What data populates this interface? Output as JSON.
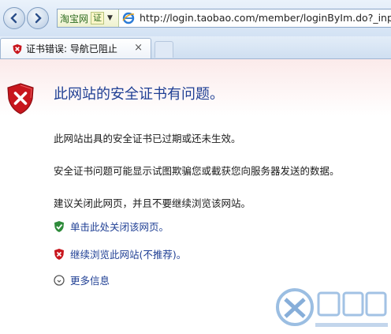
{
  "toolbar": {
    "back_icon": "back-arrow-icon",
    "forward_icon": "forward-arrow-icon",
    "compat_label": "淘宝网",
    "compat_badge": "证",
    "url": "http://login.taobao.com/member/loginByIm.do?_input_"
  },
  "tab": {
    "label": "证书错误: 导航已阻止",
    "close": "×"
  },
  "page": {
    "title": "此网站的安全证书有问题。",
    "paragraphs": [
      "此网站出具的安全证书已过期或还未生效。",
      "安全证书问题可能显示试图欺骗您或截获您向服务器发送的数据。",
      "建议关闭此网页，并且不要继续浏览该网站。"
    ],
    "actions": [
      {
        "label": "单击此处关闭该网页。",
        "icon": "green-shield-icon"
      },
      {
        "label": "继续浏览此网站(不推荐)。",
        "icon": "red-shield-icon"
      },
      {
        "label": "更多信息",
        "icon": "info-icon"
      }
    ]
  },
  "colors": {
    "title": "#1f3f94",
    "link": "#1f3f94",
    "danger": "#c8161d",
    "safe": "#2e8b3a"
  }
}
